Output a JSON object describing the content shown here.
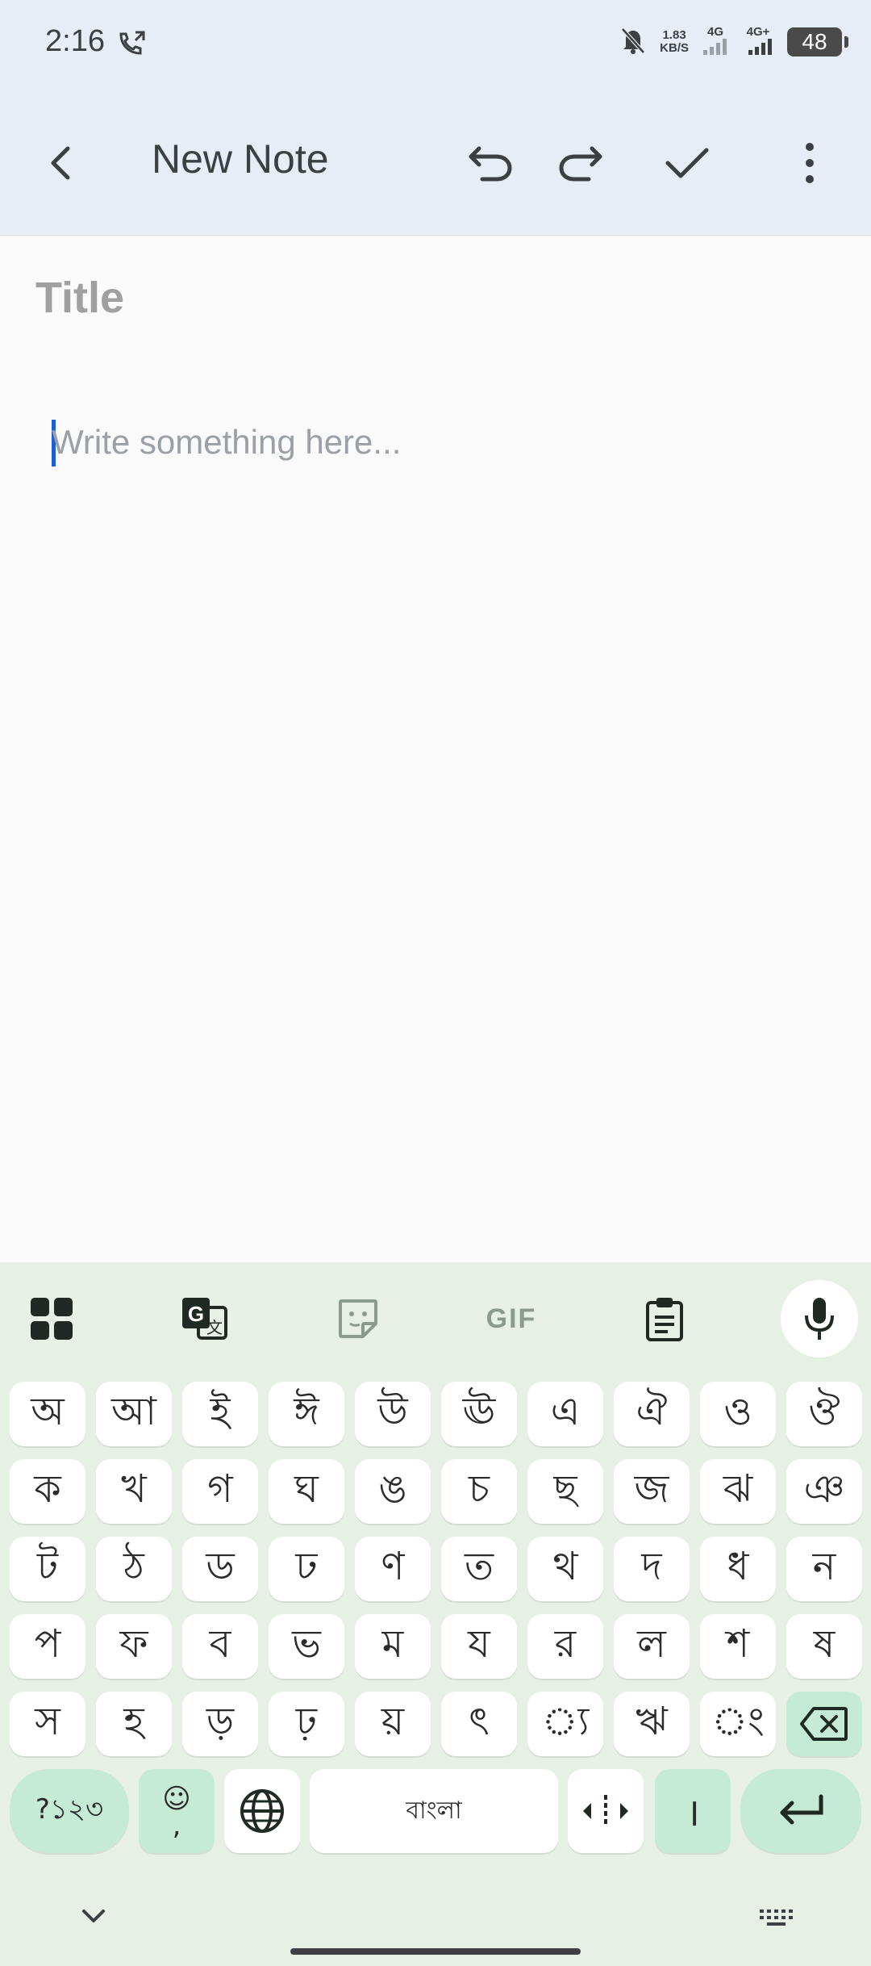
{
  "status_bar": {
    "time": "2:16",
    "net_speed_value": "1.83",
    "net_speed_unit": "KB/S",
    "sim1": "4G",
    "sim2": "4G+",
    "battery": "48"
  },
  "app_bar": {
    "title": "New Note"
  },
  "editor": {
    "title_placeholder": "Title",
    "body_placeholder": "Write something here..."
  },
  "keyboard": {
    "toolbar": [
      "apps-grid-icon",
      "translate-icon",
      "sticker-icon",
      "gif-icon",
      "clipboard-icon",
      "mic-icon"
    ],
    "gif_label": "GIF",
    "row1": [
      "অ",
      "আ",
      "ই",
      "ঈ",
      "উ",
      "ঊ",
      "এ",
      "ঐ",
      "ও",
      "ঔ"
    ],
    "row2": [
      "ক",
      "খ",
      "গ",
      "ঘ",
      "ঙ",
      "চ",
      "ছ",
      "জ",
      "ঝ",
      "ঞ"
    ],
    "row3": [
      "ট",
      "ঠ",
      "ড",
      "ঢ",
      "ণ",
      "ত",
      "থ",
      "দ",
      "ধ",
      "ন"
    ],
    "row4": [
      "প",
      "ফ",
      "ব",
      "ভ",
      "ম",
      "য",
      "র",
      "ল",
      "শ",
      "ষ"
    ],
    "row5": [
      "স",
      "হ",
      "ড়",
      "ঢ়",
      "য়",
      "ৎ",
      "্য",
      "ঋ",
      "ং"
    ],
    "symbols_key": "?১২৩",
    "emoji_key_top": "☺",
    "emoji_key_bottom": ",",
    "space_label": "বাংলা",
    "danda_key": "।"
  }
}
